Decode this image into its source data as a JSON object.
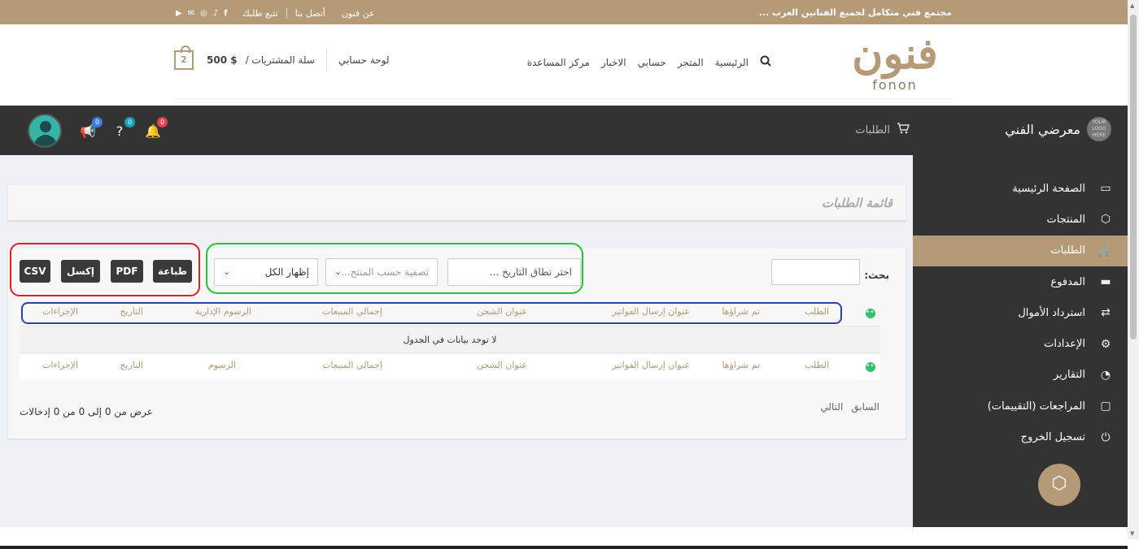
{
  "topbar": {
    "tagline": "مجتمع فني متكامل لجميع الفنانين العرب ...",
    "links": [
      "عن فنون",
      "أتصل بنا",
      "تتبع طلبك"
    ],
    "social_icons": [
      "facebook-icon",
      "tiktok-icon",
      "instagram-icon",
      "mail-icon",
      "youtube-icon"
    ]
  },
  "header": {
    "logo_ar": "فنون",
    "logo_en": "fonon",
    "nav": [
      "الرئيسية",
      "المتجر",
      "حسابي",
      "الاخبار",
      "مركز المساعدة"
    ],
    "account": "لوحة حسابي",
    "cart_label": "سلة المشتريات /",
    "cart_total": "500 $",
    "cart_count": "2"
  },
  "darkbar": {
    "brand": "معرضي الفني",
    "brand_logo": "YOUR LOGO HERE",
    "orders": "الطلبات",
    "notif_count": "0",
    "help_count": "0",
    "announce_count": "0"
  },
  "sidebar": {
    "items": [
      {
        "label": "الصفحة الرئيسية",
        "icon": "home-icon"
      },
      {
        "label": "المنتجات",
        "icon": "box-icon"
      },
      {
        "label": "الطلبات",
        "icon": "cart-icon"
      },
      {
        "label": "المدفوع",
        "icon": "card-icon"
      },
      {
        "label": "استرداد الأموال",
        "icon": "refund-icon"
      },
      {
        "label": "الإعدادات",
        "icon": "settings-icon"
      },
      {
        "label": "التقارير",
        "icon": "chart-icon"
      },
      {
        "label": "المراجعات (التقييمات)",
        "icon": "comment-icon"
      },
      {
        "label": "تسجيل الخروج",
        "icon": "power-icon"
      }
    ],
    "active_index": 2
  },
  "page": {
    "title": "قائمة الطلبات",
    "buttons": {
      "print": "طباعة",
      "pdf": "PDF",
      "excel": "إكسل",
      "csv": "CSV"
    },
    "filters": {
      "show_all": "إظهار الكل",
      "by_product": "تصفية حسب المنتج...",
      "date_range": "اختر نطاق التاريخ ..."
    },
    "search_label": "بحث:",
    "columns": [
      "الطلب",
      "تم شراؤها",
      "عنوان إرسال الفواتير",
      "عنوان الشحن",
      "إجمالي المبيعات",
      "الرسوم الإدارية",
      "التاريخ",
      "الإجراءات"
    ],
    "footer_columns": [
      "الطلب",
      "تم شراؤها",
      "عنوان إرسال الفواتير",
      "عنوان الشحن",
      "إجمالي المبيعات",
      "الرسوم",
      "التاريخ",
      "الإجراءات"
    ],
    "empty_message": "لا توجد بيانات في الجدول",
    "info": "عرض من 0 إلى 0 من 0 إدخالات",
    "prev": "السابق",
    "next": "التالي"
  }
}
